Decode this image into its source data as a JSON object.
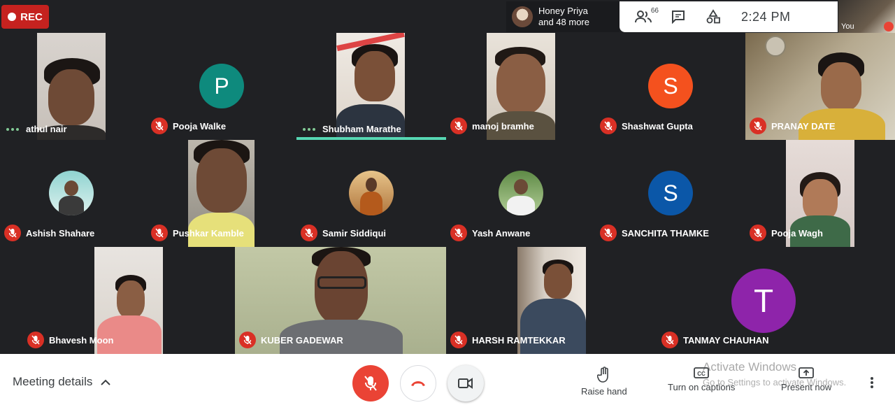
{
  "recording": {
    "label": "REC"
  },
  "presence": {
    "line1": "Honey Priya",
    "line2": "and 48 more"
  },
  "toolbar": {
    "people_count": "66",
    "time": "2:24 PM"
  },
  "self_tile": {
    "label": "You"
  },
  "participants": [
    {
      "name": "athul nair",
      "muted": false,
      "speaking": false
    },
    {
      "name": "Pooja Walke",
      "muted": true,
      "avatar_letter": "P",
      "avatar_color": "#0e8a7d"
    },
    {
      "name": "Shubham Marathe",
      "muted": false,
      "speaking": true
    },
    {
      "name": "manoj bramhe",
      "muted": true
    },
    {
      "name": "Shashwat Gupta",
      "muted": true,
      "avatar_letter": "S",
      "avatar_color": "#f4511e"
    },
    {
      "name": "PRANAY DATE",
      "muted": true
    },
    {
      "name": "Ashish Shahare",
      "muted": true
    },
    {
      "name": "Pushkar Kamble",
      "muted": true
    },
    {
      "name": "Samir Siddiqui",
      "muted": true
    },
    {
      "name": "Yash Anwane",
      "muted": true
    },
    {
      "name": "SANCHITA THAMKE",
      "muted": true,
      "avatar_letter": "S",
      "avatar_color": "#0b57a8"
    },
    {
      "name": "Pooja Wagh",
      "muted": true
    },
    {
      "name": "Bhavesh Moon",
      "muted": true
    },
    {
      "name": "KUBER GADEWAR",
      "muted": true
    },
    {
      "name": "HARSH RAMTEKKAR",
      "muted": true
    },
    {
      "name": "TANMAY CHAUHAN",
      "muted": true,
      "avatar_letter": "T",
      "avatar_color": "#8e24aa"
    }
  ],
  "bottom_bar": {
    "meeting_details": "Meeting details",
    "raise_hand": "Raise hand",
    "captions": "Turn on captions",
    "present": "Present now"
  },
  "watermark": {
    "line1": "Activate Windows",
    "line2": "Go to Settings to activate Windows."
  },
  "colors": {
    "mic_off_red": "#d93025",
    "end_call_red": "#ea4335",
    "speaking_teal": "#56d7b3"
  }
}
